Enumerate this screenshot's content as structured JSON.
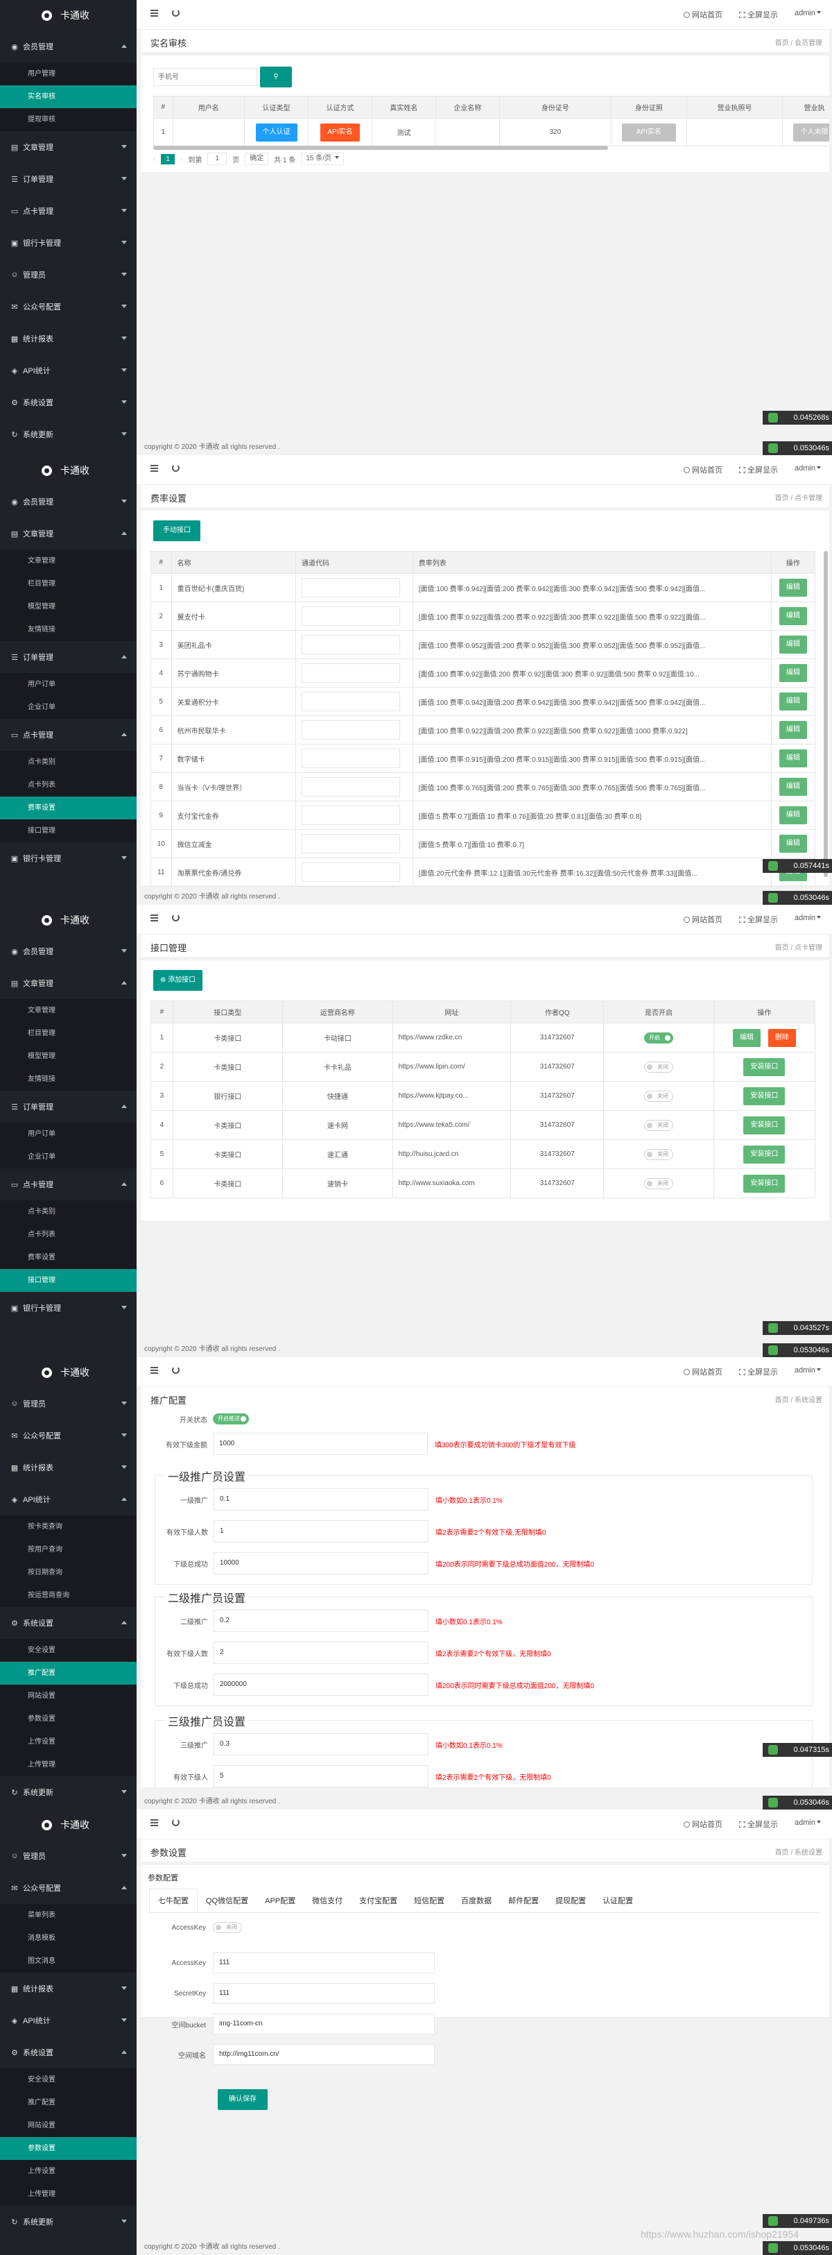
{
  "brand": "卡通收",
  "topbar": {
    "site_home": "网站首页",
    "fullscreen": "全屏显示",
    "user": "admin"
  },
  "footer_prefix": "copyright © 2020 ",
  "footer_brand": "卡通收",
  "footer_suffix": " all rights reserved .",
  "breadcrumb_home": "首页",
  "s1": {
    "sidebar_groups": [
      {
        "label": "会员管理",
        "icon": "user-icon",
        "items": [
          "用户管理",
          "实名审核",
          "提现审核"
        ],
        "active": 1,
        "open": true
      },
      {
        "label": "文章管理",
        "icon": "doc-icon",
        "items": []
      },
      {
        "label": "订单管理",
        "icon": "order-icon",
        "items": []
      },
      {
        "label": "点卡管理",
        "icon": "card-icon",
        "items": []
      },
      {
        "label": "银行卡管理",
        "icon": "bank-icon",
        "items": []
      },
      {
        "label": "管理员",
        "icon": "admin-icon",
        "items": []
      },
      {
        "label": "公众号配置",
        "icon": "wechat-icon",
        "items": []
      },
      {
        "label": "统计报表",
        "icon": "chart-icon",
        "items": []
      },
      {
        "label": "API统计",
        "icon": "api-icon",
        "items": []
      },
      {
        "label": "系统设置",
        "icon": "gear-icon",
        "items": []
      },
      {
        "label": "系统更新",
        "icon": "update-icon",
        "items": []
      }
    ],
    "title": "实名审核",
    "crumb": "会员管理",
    "search_placeholder": "手机号",
    "headers": [
      "#",
      "用户名",
      "认证类型",
      "认证方式",
      "真实姓名",
      "企业名称",
      "身份证号",
      "身份证照",
      "营业执照号",
      "营业执"
    ],
    "row": {
      "num": "1",
      "type_btn": "个人认证",
      "mode_btn": "API实名",
      "name": "测试",
      "id_no": "320",
      "photo_btn": "API实名",
      "license_btn": "个人未限"
    },
    "pager": {
      "page": "1",
      "goto_label": "到第",
      "goto_value": "1",
      "page_unit": "页",
      "confirm": "确定",
      "total": "共 1 条",
      "per_page": "15 条/页"
    },
    "timer1": "0.045268s",
    "timer2": "0.053046s"
  },
  "s2": {
    "sidebar_groups": [
      {
        "label": "会员管理",
        "icon": "user-icon",
        "items": []
      },
      {
        "label": "文章管理",
        "icon": "doc-icon",
        "items": [
          "文章管理",
          "栏目管理",
          "模型管理",
          "友情链接"
        ],
        "open": true
      },
      {
        "label": "订单管理",
        "icon": "order-icon",
        "items": [
          "用户订单",
          "企业订单"
        ],
        "open": true
      },
      {
        "label": "点卡管理",
        "icon": "card-icon",
        "items": [
          "点卡类别",
          "点卡列表",
          "费率设置",
          "接口管理"
        ],
        "active": 2,
        "open": true
      },
      {
        "label": "银行卡管理",
        "icon": "bank-icon",
        "items": []
      }
    ],
    "title": "费率设置",
    "crumb": "点卡管理",
    "add_btn": "手动接口",
    "headers": [
      "#",
      "名称",
      "通道代码",
      "费率列表",
      "操作"
    ],
    "edit_label": "编辑",
    "rows": [
      {
        "n": "1",
        "name": "重百世纪卡(重庆百货)",
        "rates": "[面值:100 费率:0.942][面值:200 费率:0.942][面值:300 费率:0.942][面值:500 费率:0.942][面值..."
      },
      {
        "n": "2",
        "name": "翼支付卡",
        "rates": "[面值:100 费率:0.922][面值:200 费率:0.922][面值:300 费率:0.922][面值:500 费率:0.922][面值..."
      },
      {
        "n": "3",
        "name": "美团礼品卡",
        "rates": "[面值:100 费率:0.952][面值:200 费率:0.952][面值:300 费率:0.952][面值:500 费率:0.952][面值..."
      },
      {
        "n": "4",
        "name": "苏宁通购物卡",
        "rates": "[面值:100 费率:0.92][面值:200 费率:0.92][面值:300 费率:0.92][面值:500 费率:0.92][面值:10..."
      },
      {
        "n": "5",
        "name": "关爱通积分卡",
        "rates": "[面值:100 费率:0.942][面值:200 费率:0.942][面值:300 费率:0.942][面值:500 费率:0.942][面值..."
      },
      {
        "n": "6",
        "name": "杭州市民联华卡",
        "rates": "[面值:100 费率:0.922][面值:200 费率:0.922][面值:500 费率:0.922][面值:1000 费率:0.922]"
      },
      {
        "n": "7",
        "name": "数字储卡",
        "rates": "[面值:100 费率:0.915][面值:200 费率:0.915][面值:300 费率:0.915][面值:500 费率:0.915][面值..."
      },
      {
        "n": "8",
        "name": "当当卡（V卡/理世界）",
        "rates": "[面值:100 费率:0.765][面值:200 费率:0.765][面值:300 费率:0.765][面值:500 费率:0.765][面值..."
      },
      {
        "n": "9",
        "name": "支付宝代金券",
        "rates": "[面值:5 费率:0.7][面值:10 费率:0.76][面值:20 费率:0.81][面值:30 费率:0.8]"
      },
      {
        "n": "10",
        "name": "微信立减金",
        "rates": "[面值:5 费率:0.7][面值:10 费率:0.7]"
      },
      {
        "n": "11",
        "name": "淘票票代金券/通兑券",
        "rates": "[面值:20元代金券 费率:12.1][面值:30元代金券 费率:16.32][面值:50元代金券 费率:33][面值..."
      }
    ],
    "timer1": "0.057441s",
    "timer2": "0.053046s"
  },
  "s3": {
    "sidebar_groups": [
      {
        "label": "会员管理",
        "icon": "user-icon",
        "items": []
      },
      {
        "label": "文章管理",
        "icon": "doc-icon",
        "items": [
          "文章管理",
          "栏目管理",
          "模型管理",
          "友情链接"
        ],
        "open": true
      },
      {
        "label": "订单管理",
        "icon": "order-icon",
        "items": [
          "用户订单",
          "企业订单"
        ],
        "open": true
      },
      {
        "label": "点卡管理",
        "icon": "card-icon",
        "items": [
          "点卡类别",
          "点卡列表",
          "费率设置",
          "接口管理"
        ],
        "active": 3,
        "open": true
      },
      {
        "label": "银行卡管理",
        "icon": "bank-icon",
        "items": []
      }
    ],
    "title": "接口管理",
    "crumb": "点卡管理",
    "add_btn": "添加接口",
    "headers": [
      "#",
      "接口类型",
      "运营商名称",
      "网址",
      "作者QQ",
      "是否开启",
      "操作"
    ],
    "on_label": "开启",
    "off_label": "关闭",
    "edit_label": "编辑",
    "del_label": "删除",
    "install_label": "安装接口",
    "rows": [
      {
        "n": "1",
        "type": "卡类接口",
        "op": "卡动接口",
        "url": "https://www.rzdke.cn",
        "qq": "314732607",
        "on": true
      },
      {
        "n": "2",
        "type": "卡类接口",
        "op": "卡卡礼品",
        "url": "https://www.lipin.com/",
        "qq": "314732607",
        "on": false
      },
      {
        "n": "3",
        "type": "银行接口",
        "op": "快捷通",
        "url": "https://www.kjtpay.co...",
        "qq": "314732607",
        "on": false
      },
      {
        "n": "4",
        "type": "卡类接口",
        "op": "速卡网",
        "url": "https://www.teka5.com/",
        "qq": "314732607",
        "on": false
      },
      {
        "n": "5",
        "type": "卡类接口",
        "op": "速汇通",
        "url": "http://huisu.jcard.cn",
        "qq": "314732607",
        "on": false
      },
      {
        "n": "6",
        "type": "卡类接口",
        "op": "速销卡",
        "url": "http://www.suxiaoka.com",
        "qq": "314732607",
        "on": false
      }
    ],
    "timer1": "0.043527s",
    "timer2": "0.053046s"
  },
  "s4": {
    "sidebar_groups": [
      {
        "label": "管理员",
        "icon": "admin-icon",
        "items": []
      },
      {
        "label": "公众号配置",
        "icon": "wechat-icon",
        "items": []
      },
      {
        "label": "统计报表",
        "icon": "chart-icon",
        "items": []
      },
      {
        "label": "API统计",
        "icon": "api-icon",
        "items": [
          "按卡类查询",
          "按用户查询",
          "按日期查询",
          "按运营商查询"
        ],
        "open": true
      },
      {
        "label": "系统设置",
        "icon": "gear-icon",
        "items": [
          "安全设置",
          "推广配置",
          "网站设置",
          "参数设置",
          "上传设置",
          "上传管理"
        ],
        "active": 1,
        "open": true
      },
      {
        "label": "系统更新",
        "icon": "update-icon",
        "items": []
      }
    ],
    "title": "推广配置",
    "crumb": "系统设置",
    "switch_label": "开关状态",
    "switch_text": "开启推送",
    "valid_label": "有效下级金额",
    "valid_value": "1000",
    "valid_hint": "填300表示要成功销卡300的下级才是有效下级",
    "levels": [
      {
        "legend": "一级推广员设置",
        "rate_label": "一级推广",
        "rate": "0.1",
        "rate_hint": "填小数如0.1表示0.1%",
        "count_label": "有效下级人数",
        "count": "1",
        "count_hint": "填2表示需要2个有效下级,无限制填0",
        "total_label": "下级总成功",
        "total": "10000",
        "total_hint": "填200表示同时需要下级总成功面值200，无限制填0"
      },
      {
        "legend": "二级推广员设置",
        "rate_label": "二级推广",
        "rate": "0.2",
        "rate_hint": "填小数如0.1表示0.1%",
        "count_label": "有效下级人数",
        "count": "2",
        "count_hint": "填2表示需要2个有效下级，无限制填0",
        "total_label": "下级总成功",
        "total": "2000000",
        "total_hint": "填200表示同时需要下级总成功面值200，无限制填0"
      },
      {
        "legend": "三级推广员设置",
        "rate_label": "三级推广",
        "rate": "0.3",
        "rate_hint": "填小数如0.1表示0.1%",
        "count_label": "有效下级人",
        "count": "5",
        "count_hint": "填2表示需要2个有效下级，无限制填0"
      }
    ],
    "timer1": "0.047315s",
    "timer2": "0.053046s"
  },
  "s5": {
    "sidebar_groups": [
      {
        "label": "管理员",
        "icon": "admin-icon",
        "items": []
      },
      {
        "label": "公众号配置",
        "icon": "wechat-icon",
        "items": [
          "菜单列表",
          "消息模板",
          "图文消息"
        ],
        "open": true
      },
      {
        "label": "统计报表",
        "icon": "chart-icon",
        "items": []
      },
      {
        "label": "API统计",
        "icon": "api-icon",
        "items": []
      },
      {
        "label": "系统设置",
        "icon": "gear-icon",
        "items": [
          "安全设置",
          "推广配置",
          "网站设置",
          "参数设置",
          "上传设置",
          "上传管理"
        ],
        "active": 3,
        "open": true
      },
      {
        "label": "系统更新",
        "icon": "update-icon",
        "items": []
      }
    ],
    "title": "参数设置",
    "crumb": "系统设置",
    "panel_title": "参数配置",
    "tabs": [
      "七牛配置",
      "QQ微信配置",
      "APP配置",
      "微信支付",
      "支付宝配置",
      "短信配置",
      "百度数据",
      "邮件配置",
      "提现配置",
      "认证配置"
    ],
    "fields": [
      {
        "label": "AccessKey",
        "value": "",
        "switch": "关闭"
      },
      {
        "label": "AccessKey",
        "value": "111"
      },
      {
        "label": "SecretKey",
        "value": "111"
      },
      {
        "label": "空间bucket",
        "value": "img-11com-cn"
      },
      {
        "label": "空间域名",
        "value": "http://img11com.cn/"
      }
    ],
    "save_btn": "确认保存",
    "watermark": "https://www.huzhan.com/ishop21954",
    "timer1": "0.049736s",
    "timer2": "0.053046s"
  }
}
